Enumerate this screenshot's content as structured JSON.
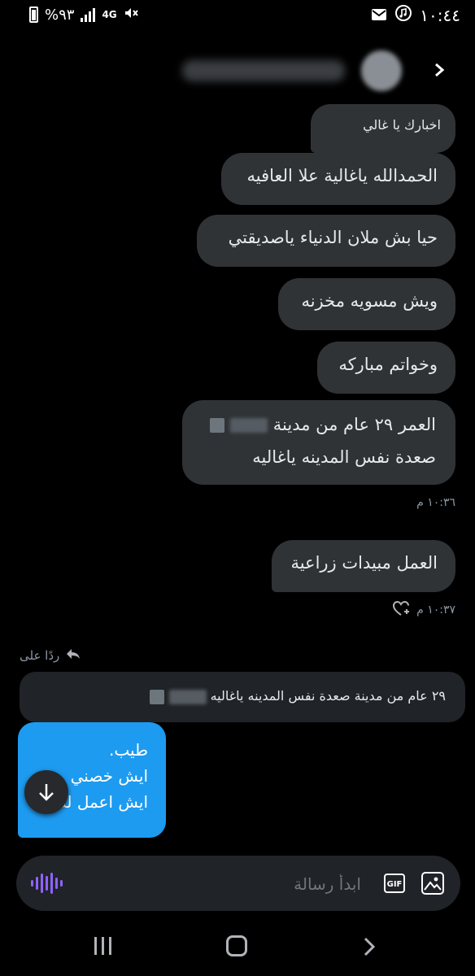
{
  "status_bar": {
    "time": "١٠:٤٤",
    "battery": "%٩٣",
    "network": "4G"
  },
  "header": {
    "back_icon": "chevron-right-icon"
  },
  "messages": [
    {
      "text": "اخبارك يا غالي"
    },
    {
      "text": "الحمدالله ياغالية علا العافيه"
    },
    {
      "text": "حيا بش ملان الدنياء ياصديقتي"
    },
    {
      "text": "ويش مسويه مخزنه"
    },
    {
      "text": "وخواتم مباركه"
    },
    {
      "line1_suffix": "العمر ٢٩ عام من مدينة",
      "line2": "صعدة نفس المدينه ياغاليه"
    },
    {
      "text": "العمل مبيدات زراعية"
    }
  ],
  "timestamps": {
    "t1": "١٠:٣٦ م",
    "t2": "١٠:٣٧ م"
  },
  "reply": {
    "label": "ردًا على",
    "quote_text": "٢٩ عام من مدينة صعدة نفس المدينه ياغاليه"
  },
  "outgoing": {
    "lines": [
      "طيب.",
      "ايش خصني",
      "ايش اعمل لك"
    ]
  },
  "composer": {
    "placeholder": "ابدأ رسالة",
    "gif_label": "GIF"
  },
  "colors": {
    "accent": "#1d9bf0",
    "bubble_bg": "#2f3336",
    "voice": "#8e63ff"
  }
}
